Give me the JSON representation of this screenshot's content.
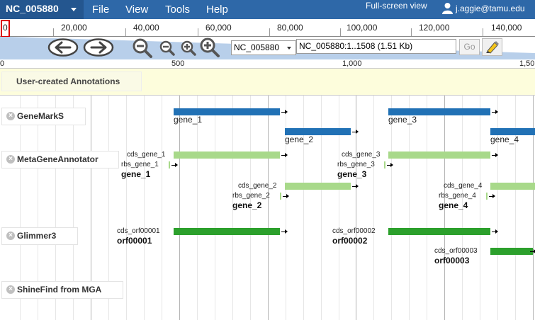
{
  "menubar": {
    "ref_name": "NC_005880",
    "menus": [
      "File",
      "View",
      "Tools",
      "Help"
    ],
    "fullscreen_label": "Full-screen view",
    "username": "j.aggie@tamu.edu"
  },
  "overview": {
    "ticks": [
      "0",
      "20,000",
      "40,000",
      "60,000",
      "80,000",
      "100,000",
      "120,000",
      "140,000"
    ]
  },
  "nav": {
    "ref_select": "NC_005880",
    "location": "NC_005880:1..1508 (1.51 Kb)",
    "go_label": "Go"
  },
  "scale": {
    "ticks": [
      "0",
      "500",
      "1,000",
      "1,50"
    ]
  },
  "tracks": {
    "user_annotations": "User-created Annotations",
    "names": [
      "GeneMarkS",
      "MetaGeneAnnotator",
      "Glimmer3",
      "ShineFind from MGA"
    ]
  },
  "features": {
    "genemarks": [
      "gene_1",
      "gene_2",
      "gene_3",
      "gene_4"
    ],
    "mga_cds": [
      "cds_gene_1",
      "cds_gene_2",
      "cds_gene_3",
      "cds_gene_4"
    ],
    "mga_rbs": [
      "rbs_gene_1",
      "rbs_gene_2",
      "rbs_gene_3",
      "rbs_gene_4"
    ],
    "mga_names": [
      "gene_1",
      "gene_2",
      "gene_3",
      "gene_4"
    ],
    "glimmer_cds": [
      "cds_orf00001",
      "cds_orf00002",
      "cds_orf00003"
    ],
    "glimmer_names": [
      "orf00001",
      "orf00002",
      "orf00003"
    ]
  },
  "colors": {
    "menubar": "#2e68a8",
    "genemarks": "#2171b5",
    "mga": "#a8d98a",
    "glimmer": "#2ca02c",
    "user_annotation_bg": "#fdfddc"
  }
}
